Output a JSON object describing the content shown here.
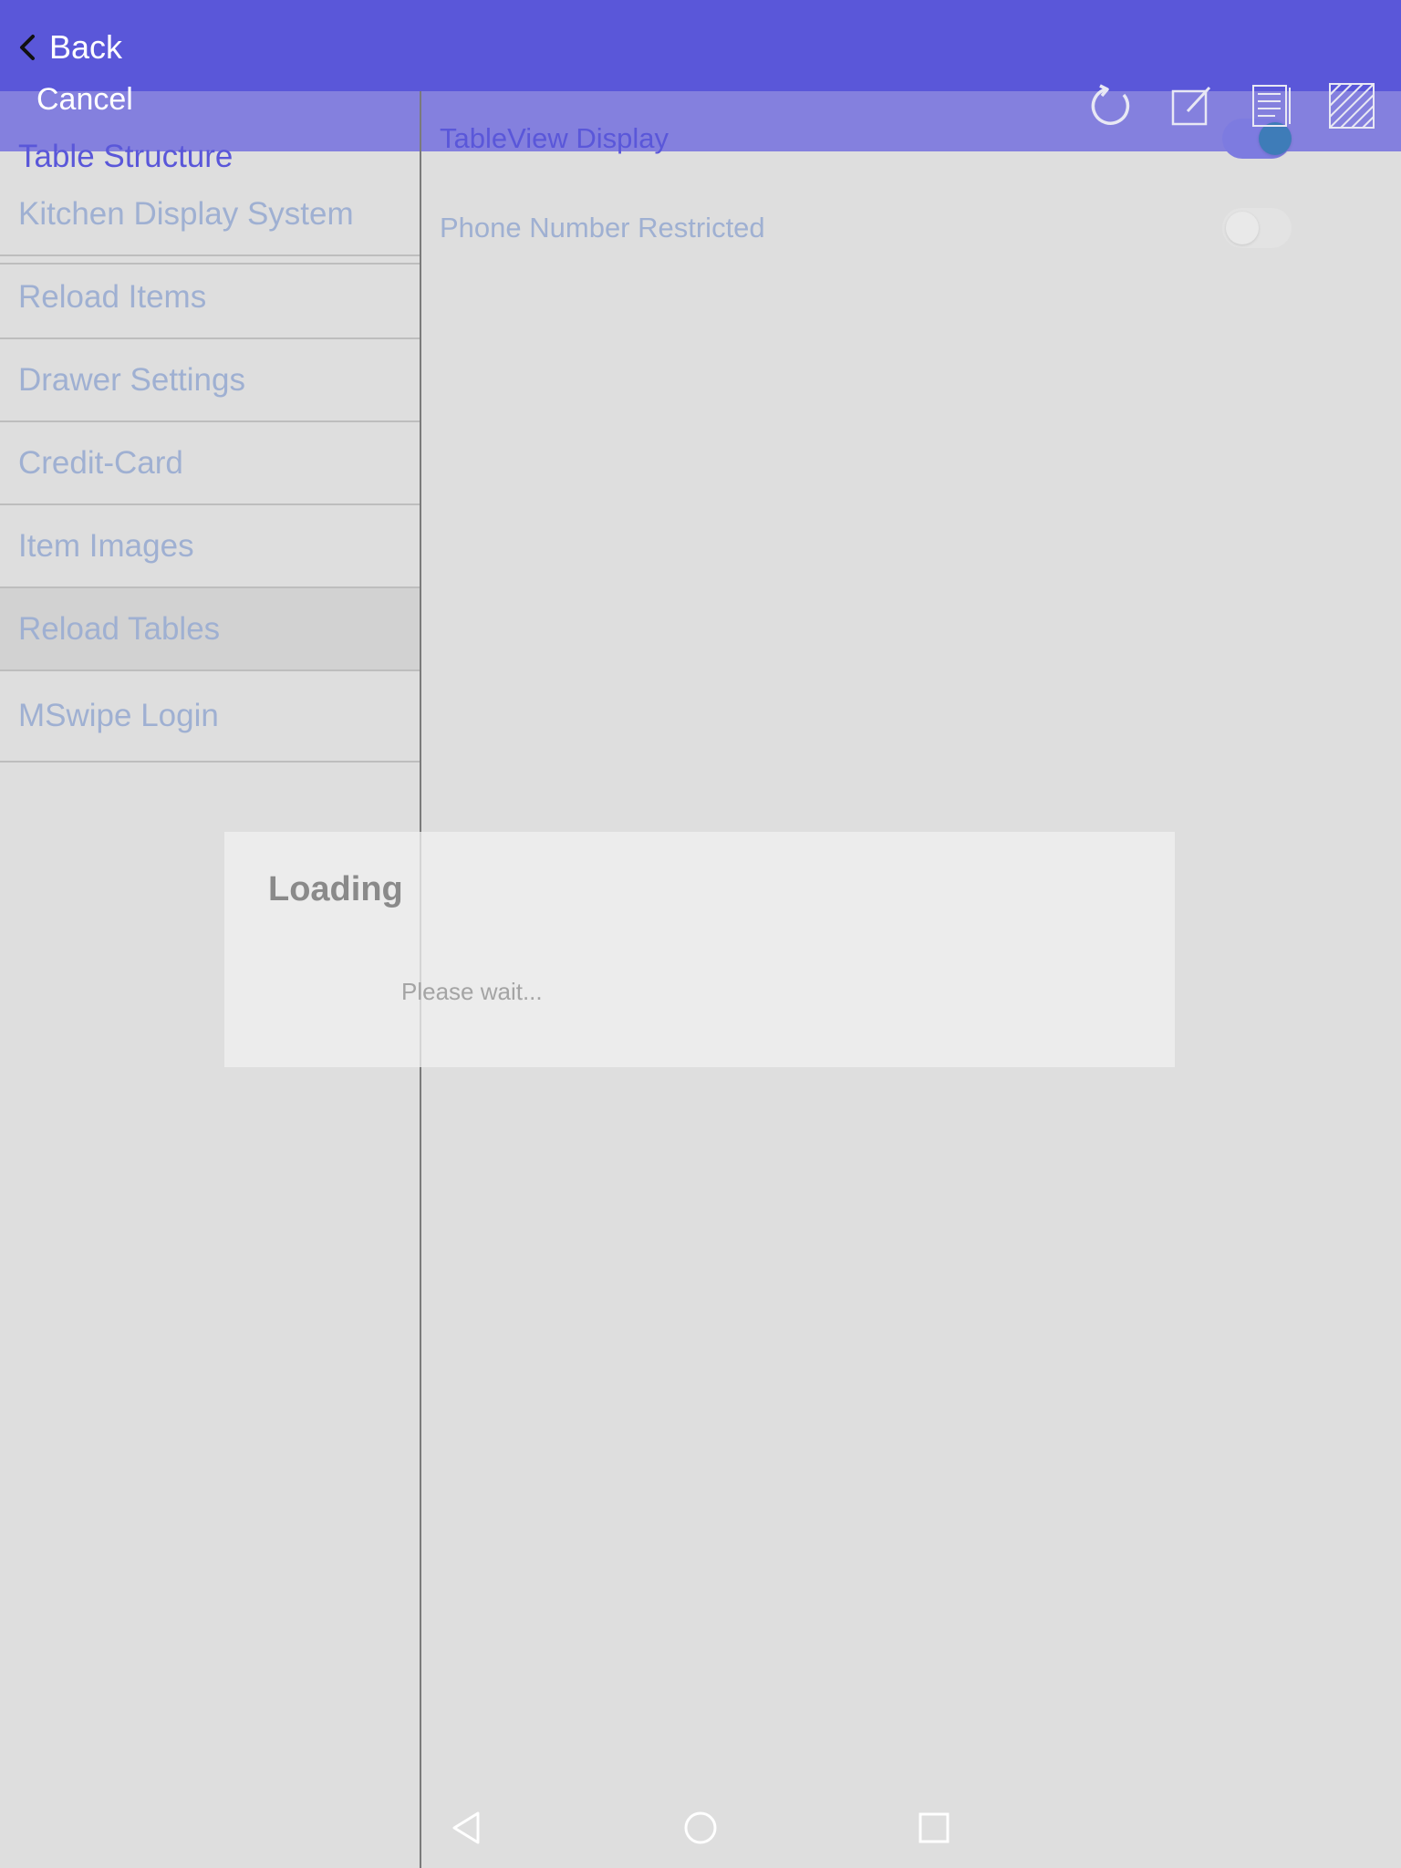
{
  "header": {
    "back_label": "Back",
    "cancel_label": "Cancel",
    "bar_color": "#5a57d9",
    "subbar_color": "#8480de"
  },
  "toolbar": {
    "icons": [
      "refresh-icon",
      "edit-icon",
      "receipt-icon",
      "pattern-icon"
    ]
  },
  "sidebar": {
    "items": [
      {
        "label": "Table Structure"
      },
      {
        "label": "Kitchen Display System"
      },
      {
        "label": "Reload Items"
      },
      {
        "label": "Drawer Settings"
      },
      {
        "label": "Credit-Card"
      },
      {
        "label": "Item Images"
      },
      {
        "label": "Reload Tables"
      },
      {
        "label": "MSwipe Login"
      }
    ],
    "selected_index": 6
  },
  "settings": {
    "rows": [
      {
        "label": "TableView Display",
        "enabled": true
      },
      {
        "label": "Phone Number Restricted",
        "enabled": false
      }
    ]
  },
  "dialog": {
    "title": "Loading",
    "message": "Please wait..."
  },
  "navbar": {
    "buttons": [
      "back-nav-icon",
      "home-nav-icon",
      "recents-nav-icon"
    ]
  }
}
